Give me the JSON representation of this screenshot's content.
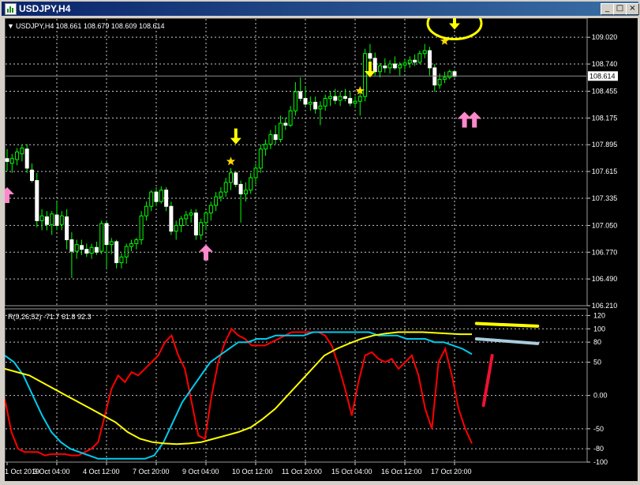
{
  "window": {
    "title": "USDJPY,H4",
    "buttons": [
      "_",
      "□",
      "×"
    ]
  },
  "header": {
    "caret": "▼",
    "text": "USDJPY,H4  108.661 108.679 108.609 108.614"
  },
  "indicator": {
    "text": "R(9,26,52) -71.7 61.8 92.3"
  },
  "chart_data": [
    {
      "type": "candlestick",
      "symbol": "USDJPY",
      "timeframe": "H4",
      "ohlc_readout": {
        "open": 108.661,
        "high": 108.679,
        "low": 108.609,
        "close": 108.614
      },
      "current_price": "108.614",
      "y_ticks": [
        "109.020",
        "108.740",
        "108.455",
        "108.175",
        "107.895",
        "107.615",
        "107.335",
        "107.050",
        "106.770",
        "106.490",
        "106.210"
      ],
      "y_tick_values": [
        109.02,
        108.74,
        108.455,
        108.175,
        107.895,
        107.615,
        107.335,
        107.05,
        106.77,
        106.49,
        106.21
      ],
      "ylim": [
        106.21,
        109.22
      ],
      "x_labels": [
        "1 Oct 2019",
        "3 Oct 04:00",
        "4 Oct 12:00",
        "7 Oct 20:00",
        "9 Oct 04:00",
        "10 Oct 12:00",
        "11 Oct 20:00",
        "15 Oct 04:00",
        "16 Oct 12:00",
        "17 Oct 20:00"
      ],
      "x_label_index": [
        0,
        10,
        20,
        30,
        40,
        50,
        60,
        70,
        80,
        90
      ],
      "bullish_color": "#00ff00",
      "bearish_color": "#ffffff",
      "candles": [
        [
          107.75,
          107.85,
          107.62,
          107.72
        ],
        [
          107.7,
          107.8,
          107.6,
          107.75
        ],
        [
          107.74,
          107.86,
          107.68,
          107.82
        ],
        [
          107.8,
          107.9,
          107.72,
          107.86
        ],
        [
          107.85,
          107.9,
          107.6,
          107.65
        ],
        [
          107.63,
          107.7,
          107.5,
          107.52
        ],
        [
          107.52,
          107.6,
          107.03,
          107.1
        ],
        [
          107.1,
          107.22,
          107.0,
          107.15
        ],
        [
          107.14,
          107.2,
          107.0,
          107.06
        ],
        [
          107.06,
          107.2,
          106.95,
          107.17
        ],
        [
          107.16,
          107.3,
          107.0,
          107.05
        ],
        [
          107.06,
          107.2,
          107.0,
          107.15
        ],
        [
          107.14,
          107.22,
          106.8,
          106.9
        ],
        [
          106.9,
          106.98,
          106.5,
          106.78
        ],
        [
          106.78,
          106.9,
          106.7,
          106.85
        ],
        [
          106.84,
          106.9,
          106.74,
          106.8
        ],
        [
          106.8,
          106.86,
          106.72,
          106.76
        ],
        [
          106.76,
          106.86,
          106.7,
          106.82
        ],
        [
          106.82,
          106.88,
          106.74,
          106.77
        ],
        [
          106.78,
          107.1,
          106.75,
          107.07
        ],
        [
          107.07,
          107.1,
          106.6,
          106.85
        ],
        [
          106.85,
          106.92,
          106.75,
          106.88
        ],
        [
          106.88,
          106.9,
          106.6,
          106.66
        ],
        [
          106.66,
          106.76,
          106.6,
          106.72
        ],
        [
          106.72,
          106.86,
          106.65,
          106.83
        ],
        [
          106.83,
          106.9,
          106.78,
          106.86
        ],
        [
          106.86,
          106.92,
          106.8,
          106.9
        ],
        [
          106.9,
          107.2,
          106.85,
          107.15
        ],
        [
          107.15,
          107.3,
          107.1,
          107.25
        ],
        [
          107.25,
          107.42,
          107.2,
          107.4
        ],
        [
          107.4,
          107.45,
          107.25,
          107.3
        ],
        [
          107.3,
          107.46,
          107.28,
          107.42
        ],
        [
          107.42,
          107.45,
          107.2,
          107.25
        ],
        [
          107.25,
          107.3,
          106.95,
          106.99
        ],
        [
          106.99,
          107.1,
          106.9,
          107.05
        ],
        [
          107.05,
          107.15,
          106.98,
          107.12
        ],
        [
          107.12,
          107.2,
          107.05,
          107.16
        ],
        [
          107.16,
          107.22,
          107.08,
          107.18
        ],
        [
          107.18,
          107.22,
          106.9,
          106.95
        ],
        [
          106.95,
          107.12,
          106.9,
          107.08
        ],
        [
          107.08,
          107.2,
          107.0,
          107.18
        ],
        [
          107.18,
          107.3,
          107.1,
          107.26
        ],
        [
          107.26,
          107.4,
          107.2,
          107.35
        ],
        [
          107.35,
          107.45,
          107.3,
          107.4
        ],
        [
          107.4,
          107.55,
          107.35,
          107.5
        ],
        [
          107.5,
          107.65,
          107.42,
          107.6
        ],
        [
          107.6,
          107.62,
          107.45,
          107.48
        ],
        [
          107.48,
          107.52,
          107.08,
          107.38
        ],
        [
          107.38,
          107.5,
          107.3,
          107.42
        ],
        [
          107.42,
          107.6,
          107.38,
          107.55
        ],
        [
          107.55,
          107.7,
          107.48,
          107.65
        ],
        [
          107.65,
          107.9,
          107.6,
          107.85
        ],
        [
          107.85,
          107.95,
          107.78,
          107.9
        ],
        [
          107.9,
          108.05,
          107.85,
          108.0
        ],
        [
          108.0,
          108.1,
          107.9,
          107.95
        ],
        [
          107.95,
          108.2,
          107.92,
          108.12
        ],
        [
          108.12,
          108.18,
          108.05,
          108.1
        ],
        [
          108.1,
          108.3,
          108.08,
          108.25
        ],
        [
          108.25,
          108.55,
          108.2,
          108.45
        ],
        [
          108.45,
          108.6,
          108.35,
          108.38
        ],
        [
          108.38,
          108.5,
          108.3,
          108.32
        ],
        [
          108.32,
          108.4,
          108.25,
          108.34
        ],
        [
          108.34,
          108.4,
          108.22,
          108.27
        ],
        [
          108.27,
          108.35,
          108.1,
          108.3
        ],
        [
          108.3,
          108.42,
          108.25,
          108.38
        ],
        [
          108.38,
          108.45,
          108.3,
          108.4
        ],
        [
          108.4,
          108.48,
          108.32,
          108.36
        ],
        [
          108.36,
          108.45,
          108.3,
          108.4
        ],
        [
          108.4,
          108.48,
          108.35,
          108.38
        ],
        [
          108.38,
          108.45,
          108.3,
          108.33
        ],
        [
          108.33,
          108.4,
          108.28,
          108.35
        ],
        [
          108.35,
          108.45,
          108.2,
          108.4
        ],
        [
          108.4,
          108.9,
          108.35,
          108.85
        ],
        [
          108.85,
          108.95,
          108.75,
          108.8
        ],
        [
          108.8,
          108.86,
          108.62,
          108.66
        ],
        [
          108.66,
          108.75,
          108.6,
          108.72
        ],
        [
          108.72,
          108.8,
          108.65,
          108.7
        ],
        [
          108.7,
          108.78,
          108.64,
          108.74
        ],
        [
          108.74,
          108.82,
          108.68,
          108.7
        ],
        [
          108.7,
          108.76,
          108.62,
          108.73
        ],
        [
          108.73,
          108.8,
          108.68,
          108.75
        ],
        [
          108.75,
          108.82,
          108.7,
          108.78
        ],
        [
          108.78,
          108.84,
          108.72,
          108.76
        ],
        [
          108.76,
          108.88,
          108.74,
          108.85
        ],
        [
          108.85,
          108.95,
          108.8,
          108.88
        ],
        [
          108.88,
          108.92,
          108.62,
          108.7
        ],
        [
          108.7,
          108.74,
          108.45,
          108.52
        ],
        [
          108.52,
          108.64,
          108.48,
          108.58
        ],
        [
          108.58,
          108.66,
          108.54,
          108.6
        ],
        [
          108.6,
          108.68,
          108.58,
          108.66
        ],
        [
          108.66,
          108.68,
          108.6,
          108.61
        ]
      ],
      "annotations": [
        {
          "kind": "down-arrow",
          "color": "#ffff00",
          "index": 46,
          "price": 107.9
        },
        {
          "kind": "down-arrow",
          "color": "#ffff00",
          "index": 73,
          "price": 108.6
        },
        {
          "kind": "down-arrow",
          "color": "#ffff00",
          "index": 90,
          "price": 109.1
        },
        {
          "kind": "star",
          "color": "#ffd700",
          "index": 45,
          "price": 107.72
        },
        {
          "kind": "star",
          "color": "#ffd700",
          "index": 71,
          "price": 108.46
        },
        {
          "kind": "star",
          "color": "#ffd700",
          "index": 88,
          "price": 108.98
        },
        {
          "kind": "up-arrow",
          "color": "#ff88cc",
          "index": 0,
          "price": 107.45
        },
        {
          "kind": "up-arrow",
          "color": "#ff88cc",
          "index": 40,
          "price": 106.85
        },
        {
          "kind": "up-arrow",
          "color": "#ff88cc",
          "index": 92,
          "price": 108.24
        },
        {
          "kind": "up-arrow",
          "color": "#ff88cc",
          "index": 94,
          "price": 108.24
        },
        {
          "kind": "ellipse",
          "color": "#ffff00",
          "index": 90,
          "price": 109.1
        }
      ]
    },
    {
      "type": "line",
      "title": "R(9,26,52) -71.7 61.8 92.3",
      "ylim": [
        -100,
        130
      ],
      "y_ticks": [
        "120",
        "100",
        "80",
        "50",
        "0.00",
        "-50",
        "-80",
        "-100"
      ],
      "y_tick_values": [
        120,
        100,
        80,
        50,
        0,
        -50,
        -80,
        -100
      ],
      "series": [
        {
          "color": "#ff0000",
          "values": [
            -5,
            -55,
            -80,
            -85,
            -85,
            -85,
            -90,
            -88,
            -88,
            -88,
            -90,
            -90,
            -85,
            -80,
            -70,
            -30,
            10,
            30,
            20,
            35,
            30,
            40,
            50,
            60,
            80,
            90,
            60,
            40,
            -10,
            -60,
            -65,
            0,
            50,
            80,
            100,
            90,
            85,
            75,
            75,
            75,
            80,
            85,
            90,
            95,
            95,
            95,
            95,
            95,
            90,
            75,
            45,
            10,
            -30,
            20,
            60,
            65,
            55,
            50,
            55,
            40,
            50,
            60,
            30,
            -20,
            -50,
            50,
            70,
            30,
            -20,
            -50,
            -72
          ]
        },
        {
          "color": "#00ccee",
          "values": [
            60,
            50,
            30,
            0,
            -30,
            -55,
            -70,
            -80,
            -85,
            -90,
            -95,
            -95,
            -95,
            -95,
            -95,
            -95,
            -90,
            -70,
            -40,
            -10,
            10,
            30,
            50,
            60,
            70,
            80,
            80,
            85,
            85,
            90,
            90,
            90,
            90,
            95,
            95,
            95,
            95,
            95,
            95,
            95,
            90,
            90,
            90,
            85,
            85,
            85,
            80,
            80,
            75,
            70,
            62
          ]
        },
        {
          "color": "#ffff00",
          "values": [
            40,
            35,
            30,
            20,
            10,
            0,
            -10,
            -20,
            -30,
            -40,
            -55,
            -65,
            -70,
            -72,
            -73,
            -72,
            -70,
            -65,
            -60,
            -55,
            -48,
            -35,
            -20,
            0,
            20,
            40,
            60,
            70,
            78,
            85,
            90,
            93,
            95,
            95,
            95,
            94,
            93,
            92,
            92
          ]
        }
      ],
      "annotations": [
        {
          "kind": "stroke",
          "color": "#ffff00",
          "from": [
            0.81,
            108
          ],
          "to": [
            0.915,
            104
          ]
        },
        {
          "kind": "stroke",
          "color": "#aaccdd",
          "from": [
            0.81,
            85
          ],
          "to": [
            0.915,
            78
          ]
        },
        {
          "kind": "stroke",
          "color": "#ee1133",
          "from": [
            0.822,
            -15
          ],
          "to": [
            0.837,
            60
          ]
        }
      ]
    }
  ]
}
